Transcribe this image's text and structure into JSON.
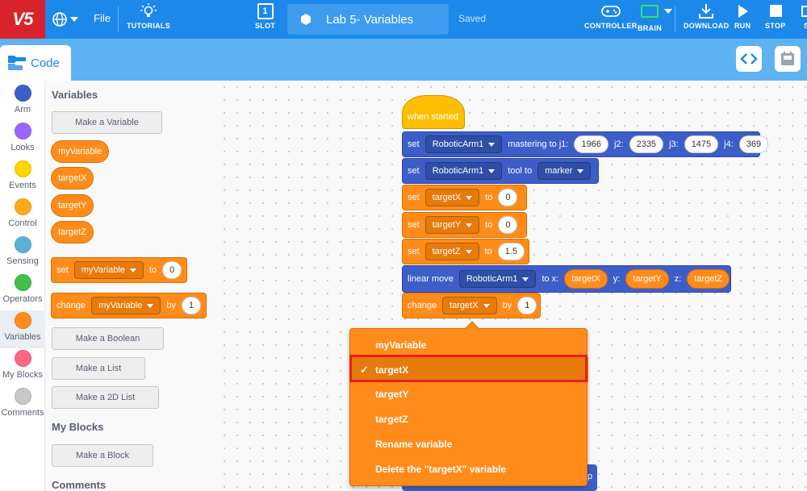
{
  "topbar": {
    "logo": "V5",
    "file_label": "File",
    "tutorials_label": "TUTORIALS",
    "slot_label": "SLOT",
    "slot_number": "1",
    "project_title": "Lab 5- Variables",
    "saved_status": "Saved",
    "controller_label": "CONTROLLER",
    "brain_label": "BRAIN",
    "download_label": "DOWNLOAD",
    "run_label": "RUN",
    "stop_label": "STOP",
    "share_label": "S"
  },
  "subbar": {
    "code_tab": "Code"
  },
  "categories": [
    {
      "label": "Arm",
      "color": "#3d5ec9"
    },
    {
      "label": "Looks",
      "color": "#9966ff"
    },
    {
      "label": "Events",
      "color": "#ffd500"
    },
    {
      "label": "Control",
      "color": "#ffab19"
    },
    {
      "label": "Sensing",
      "color": "#5cb1d6"
    },
    {
      "label": "Operators",
      "color": "#40bf4a"
    },
    {
      "label": "Variables",
      "color": "#ff8c1a"
    },
    {
      "label": "My Blocks",
      "color": "#ff6680"
    },
    {
      "label": "Comments",
      "color": "#c8c8c8"
    }
  ],
  "flyout": {
    "variables_heading": "Variables",
    "make_variable": "Make a Variable",
    "variable_reporters": [
      "myVariable",
      "targetX",
      "targetY",
      "targetZ"
    ],
    "set_block": {
      "label": "set",
      "var": "myVariable",
      "to": "to",
      "value": "0"
    },
    "change_block": {
      "label": "change",
      "var": "myVariable",
      "by": "by",
      "value": "1"
    },
    "make_boolean": "Make a Boolean",
    "make_list": "Make a List",
    "make_2d_list": "Make a 2D List",
    "my_blocks_heading": "My Blocks",
    "make_block": "Make a Block",
    "comments_heading": "Comments"
  },
  "script": {
    "hat": "when started",
    "b1": {
      "set": "set",
      "arm": "RoboticArm1",
      "label": "mastering to j1:",
      "j1": "1966",
      "j2_label": "j2:",
      "j2": "2335",
      "j3_label": "j3:",
      "j3": "1475",
      "j4_label": "j4:",
      "j4": "369"
    },
    "b2": {
      "set": "set",
      "arm": "RoboticArm1",
      "label": "tool to",
      "tool": "marker"
    },
    "b3": {
      "set": "set",
      "var": "targetX",
      "to": "to",
      "value": "0"
    },
    "b4": {
      "set": "set",
      "var": "targetY",
      "to": "to",
      "value": "0"
    },
    "b5": {
      "set": "set",
      "var": "targetZ",
      "to": "to",
      "value": "1.5"
    },
    "b6": {
      "label": "linear move",
      "arm": "RoboticArm1",
      "x_label": "to x:",
      "x": "targetX",
      "y_label": "y:",
      "y": "targetY",
      "z_label": "z:",
      "z": "targetZ"
    },
    "b7": {
      "label": "change",
      "var": "targetX",
      "by": "by",
      "value": "1"
    },
    "peek_text": "p"
  },
  "dropdown_menu": {
    "items": [
      "myVariable",
      "targetX",
      "targetY",
      "targetZ",
      "Rename variable",
      "Delete the \"targetX\" variable"
    ],
    "selected_item": "targetX",
    "check_mark": "✓"
  }
}
